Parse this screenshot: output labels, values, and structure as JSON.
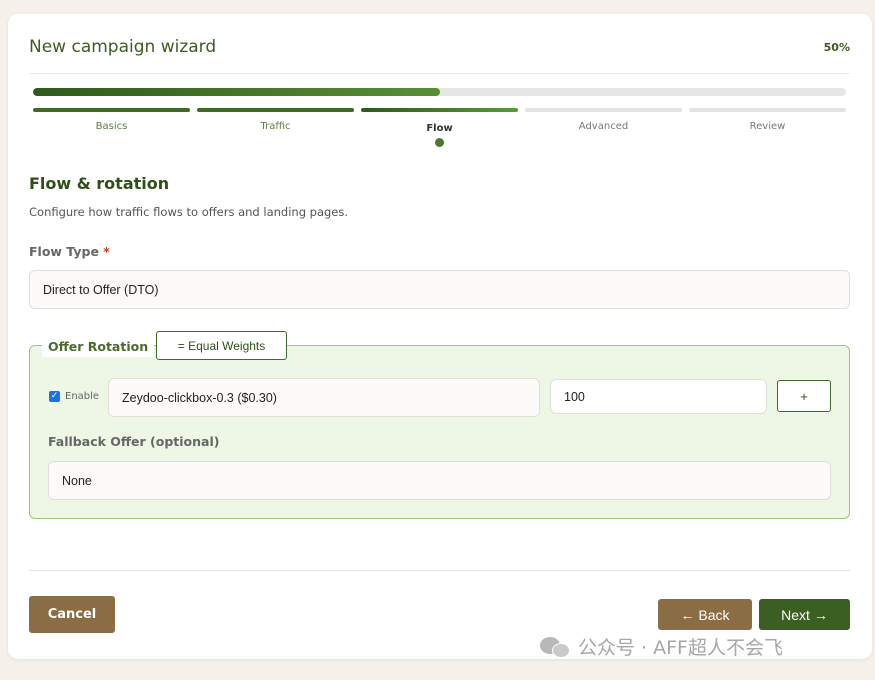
{
  "wizard": {
    "title": "New campaign wizard",
    "percent_label": "50%",
    "progress": 0.5
  },
  "steps": [
    {
      "label": "Basics",
      "state": "done"
    },
    {
      "label": "Traffic",
      "state": "done"
    },
    {
      "label": "Flow",
      "state": "current"
    },
    {
      "label": "Advanced",
      "state": "todo"
    },
    {
      "label": "Review",
      "state": "todo"
    }
  ],
  "section": {
    "title": "Flow & rotation",
    "description": "Configure how traffic flows to offers and landing pages."
  },
  "flow_type": {
    "label": "Flow Type",
    "required_mark": "*",
    "value": "Direct to Offer (DTO)"
  },
  "offer_rotation": {
    "legend": "Offer Rotation",
    "equal_weights_label": "= Equal Weights",
    "rows": [
      {
        "enabled": true,
        "enable_label": "Enable",
        "offer": "Zeydoo-clickbox-0.3 ($0.30)",
        "weight": "100"
      }
    ],
    "add_label": "+",
    "fallback_label": "Fallback Offer (optional)",
    "fallback_value": "None"
  },
  "footer": {
    "cancel_label": "Cancel",
    "back_label": "← Back",
    "next_label": "Next →"
  },
  "watermark": {
    "text": "公众号 · AFF超人不会飞"
  },
  "colors": {
    "primary_green": "#3b5e22",
    "brown": "#8a6d45",
    "panel_bg": "#eef6e6",
    "panel_border": "#9fc27e"
  }
}
